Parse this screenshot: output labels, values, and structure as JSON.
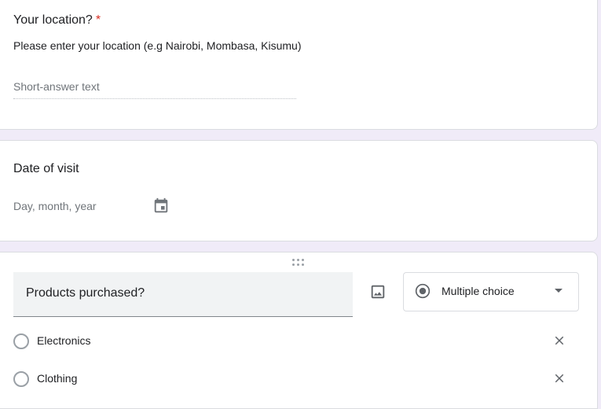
{
  "question_location": {
    "title": "Your location?",
    "required_marker": "*",
    "description": "Please enter your location (e.g Nairobi, Mombasa, Kisumu)",
    "answer_placeholder": "Short-answer text"
  },
  "question_date": {
    "title": "Date of visit",
    "placeholder": "Day, month, year",
    "icon": "calendar-icon"
  },
  "question_products": {
    "title": "Products purchased?",
    "type_selected": "Multiple choice",
    "options": [
      {
        "label": "Electronics"
      },
      {
        "label": "Clothing"
      }
    ]
  },
  "colors": {
    "accent": "#673ab7",
    "background": "#f0ebf8",
    "required": "#d93025"
  }
}
